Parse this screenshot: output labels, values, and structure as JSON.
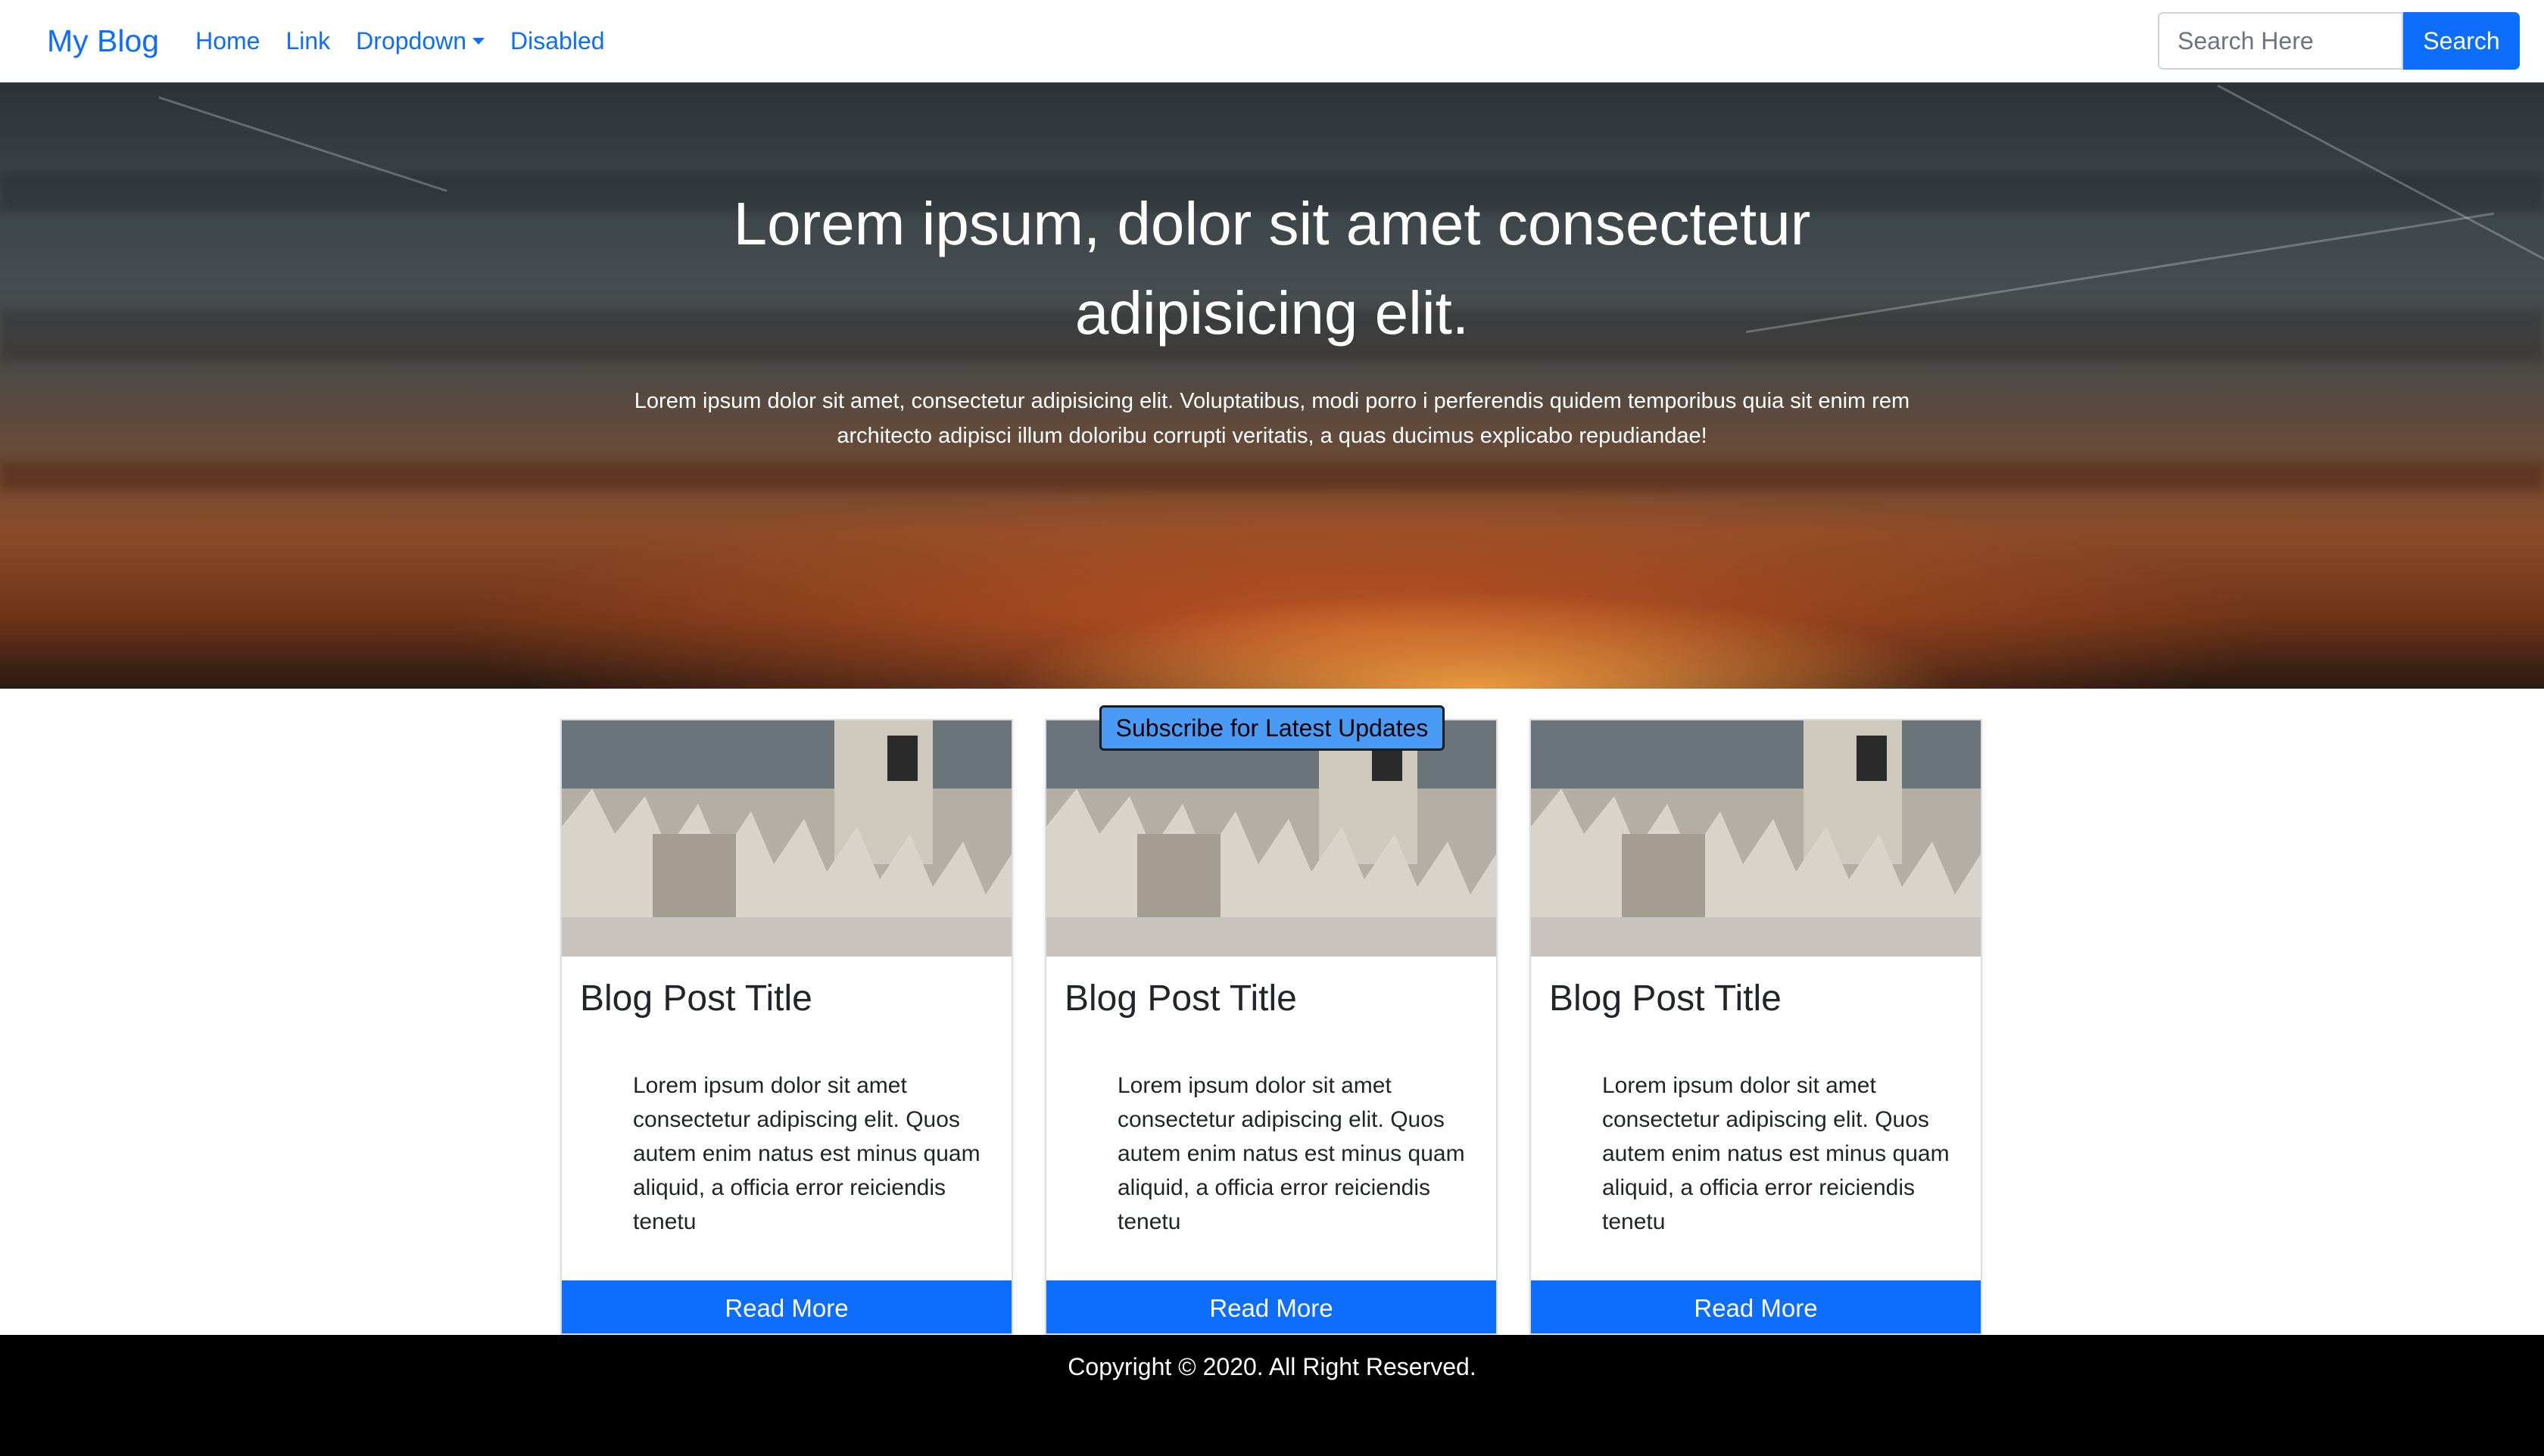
{
  "navbar": {
    "brand": "My Blog",
    "links": [
      {
        "label": "Home"
      },
      {
        "label": "Link"
      },
      {
        "label": "Dropdown"
      },
      {
        "label": "Disabled"
      }
    ],
    "search": {
      "placeholder": "Search Here",
      "button_label": "Search"
    }
  },
  "hero": {
    "title": "Lorem ipsum, dolor sit amet consectetur adipisicing elit.",
    "text": "Lorem ipsum dolor sit amet, consectetur adipisicing elit. Voluptatibus, modi porro i perferendis quidem temporibus quia sit enim rem architecto adipisci illum doloribu corrupti veritatis, a quas ducimus explicabo repudiandae!"
  },
  "subscribe": {
    "label": "Subscribe for Latest Updates"
  },
  "cards": [
    {
      "title": "Blog Post Title",
      "text": "Lorem ipsum dolor sit amet consectetur adipiscing elit. Quos autem enim natus est minus quam aliquid, a officia error reiciendis tenetu",
      "button": "Read More"
    },
    {
      "title": "Blog Post Title",
      "text": "Lorem ipsum dolor sit amet consectetur adipiscing elit. Quos autem enim natus est minus quam aliquid, a officia error reiciendis tenetu",
      "button": "Read More"
    },
    {
      "title": "Blog Post Title",
      "text": "Lorem ipsum dolor sit amet consectetur adipiscing elit. Quos autem enim natus est minus quam aliquid, a officia error reiciendis tenetu",
      "button": "Read More"
    }
  ],
  "footer": {
    "text": "Copyright © 2020. All Right Reserved."
  },
  "colors": {
    "primary": "#0d6efd",
    "footer_bg": "#000000",
    "subscribe_bg": "#4a9bf5"
  }
}
